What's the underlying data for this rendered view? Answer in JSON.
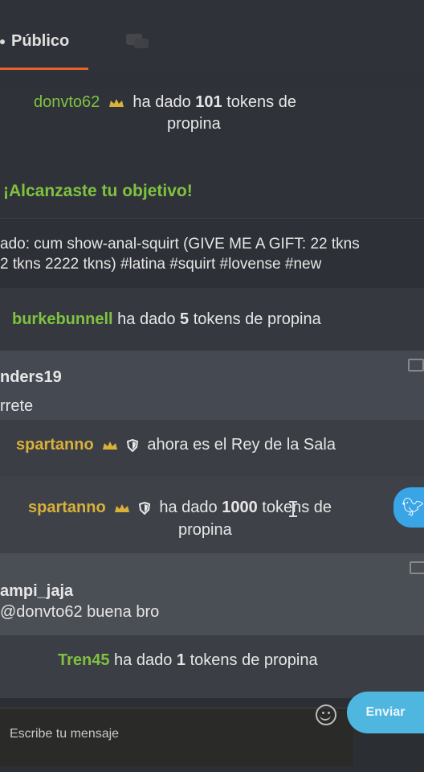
{
  "tabs": {
    "public_label": "Público"
  },
  "messages": {
    "donvto": {
      "user": "donvto62",
      "text_prefix": "ha dado",
      "amount": "101",
      "text_suffix_line1": "tokens de",
      "text_suffix_line2": "propina"
    },
    "objetivo": {
      "text": "¡Alcanzaste tu objetivo!"
    },
    "topic": {
      "line1": "ado: cum show-anal-squirt (GIVE ME A GIFT: 22 tkns",
      "line2": "2 tkns 2222 tkns) #latina #squirt #lovense #new"
    },
    "burke": {
      "user": "burkebunnell",
      "text_prefix": "ha dado",
      "amount": "5",
      "text_suffix": "tokens de propina"
    },
    "nders": {
      "user": "nders19",
      "text": "rrete"
    },
    "sparta_king": {
      "user": "spartanno",
      "text": "ahora es el Rey de la Sala"
    },
    "sparta_tip": {
      "user": "spartanno",
      "text_prefix": "ha dado",
      "amount": "1000",
      "text_suffix_line1": "tokens de",
      "text_suffix_line2": "propina"
    },
    "ampi": {
      "user": "ampi_jaja",
      "mention": "@donvto62",
      "text": "buena bro"
    },
    "tren": {
      "user": "Tren45",
      "text_prefix": "ha dado",
      "amount": "1",
      "text_suffix": "tokens de propina"
    }
  },
  "composer": {
    "placeholder": "Escribe tu mensaje",
    "send_label": "Enviar"
  },
  "icons": {
    "crown": "crown-icon",
    "shield": "shield-icon",
    "flag": "flag-icon",
    "emoji": "emoji-icon",
    "twitter": "twitter-icon"
  },
  "colors": {
    "green_user": "#7fc241",
    "gold_user": "#d9b03a",
    "accent": "#e8632b",
    "send": "#4fb6e0"
  }
}
